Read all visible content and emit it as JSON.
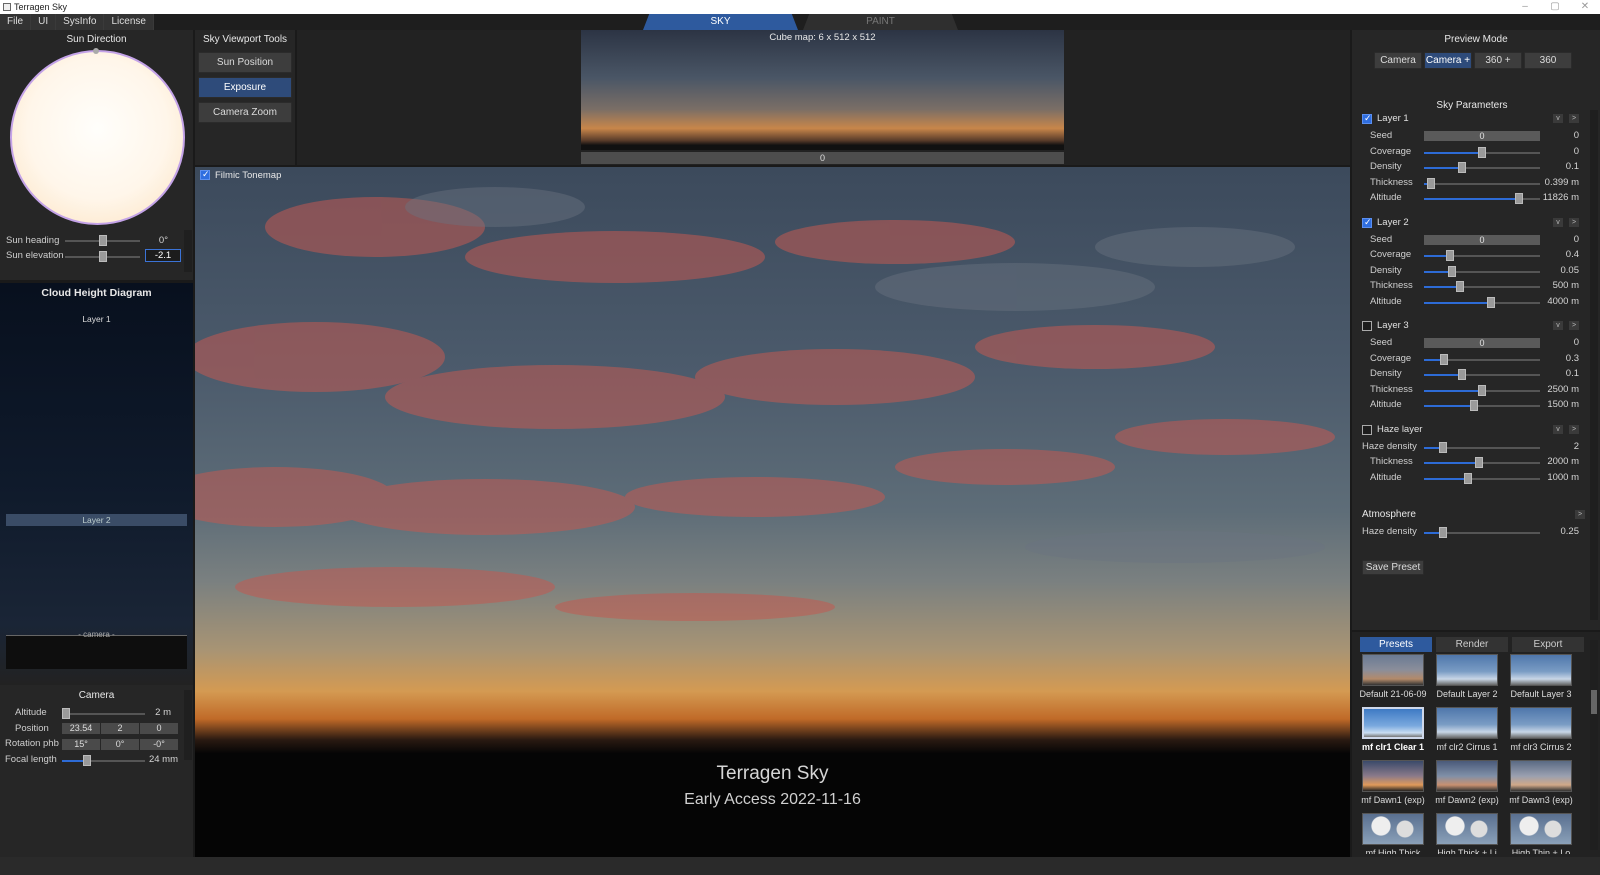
{
  "window": {
    "title": "Terragen Sky",
    "controls": [
      "–",
      "▢",
      "✕"
    ]
  },
  "menu": [
    "File",
    "UI",
    "SysInfo",
    "License"
  ],
  "top_tabs": [
    {
      "label": "SKY",
      "active": true
    },
    {
      "label": "PAINT",
      "active": false
    }
  ],
  "sun_direction": {
    "title": "Sun Direction"
  },
  "sun": {
    "heading_label": "Sun heading",
    "heading_value": "0°",
    "heading_pos": 0.5,
    "elevation_label": "Sun elevation",
    "elevation_value": "-2.1",
    "elevation_pos": 0.5
  },
  "viewport_tools": {
    "title": "Sky Viewport Tools",
    "buttons": [
      {
        "label": "Sun Position",
        "active": false
      },
      {
        "label": "Exposure",
        "active": true
      },
      {
        "label": "Camera Zoom",
        "active": false
      }
    ]
  },
  "cubemap": {
    "label": "Cube map: 6 x 512 x 512",
    "bar_value": "0"
  },
  "filmic": {
    "label": "Filmic Tonemap",
    "checked": true
  },
  "viewport_text": {
    "title": "Terragen Sky",
    "subtitle": "Early Access 2022-11-16"
  },
  "cloud_diagram": {
    "title": "Cloud Height Diagram",
    "layer1": "Layer 1",
    "layer2": "Layer 2",
    "camera": "- camera -"
  },
  "camera": {
    "title": "Camera",
    "altitude_label": "Altitude",
    "altitude_value": "2 m",
    "altitude_pos": 0.05,
    "position_label": "Position",
    "position_values": [
      "23.54",
      "2",
      "0"
    ],
    "rotation_label": "Rotation phb",
    "rotation_values": [
      "15°",
      "0°",
      "-0°"
    ],
    "focal_label": "Focal length",
    "focal_value": "24 mm",
    "focal_pos": 0.3
  },
  "preview_mode": {
    "title": "Preview Mode",
    "buttons": [
      {
        "label": "Camera",
        "active": false
      },
      {
        "label": "Camera +",
        "active": true
      },
      {
        "label": "360 +",
        "active": false
      },
      {
        "label": "360",
        "active": false
      }
    ]
  },
  "sky_params": {
    "title": "Sky Parameters",
    "layers": [
      {
        "name": "Layer 1",
        "checked": true,
        "rows": [
          {
            "label": "Seed",
            "value": "0",
            "seed": true,
            "seed_value": "0"
          },
          {
            "label": "Coverage",
            "value": "0",
            "pos": 0.5
          },
          {
            "label": "Density",
            "value": "0.1",
            "pos": 0.33
          },
          {
            "label": "Thickness",
            "value": "0.399 m",
            "pos": 0.06
          },
          {
            "label": "Altitude",
            "value": "11826 m",
            "pos": 0.82
          }
        ]
      },
      {
        "name": "Layer 2",
        "checked": true,
        "rows": [
          {
            "label": "Seed",
            "value": "0",
            "seed": true,
            "seed_value": "0"
          },
          {
            "label": "Coverage",
            "value": "0.4",
            "pos": 0.22
          },
          {
            "label": "Density",
            "value": "0.05",
            "pos": 0.24
          },
          {
            "label": "Thickness",
            "value": "500 m",
            "pos": 0.31
          },
          {
            "label": "Altitude",
            "value": "4000 m",
            "pos": 0.58
          }
        ]
      },
      {
        "name": "Layer 3",
        "checked": false,
        "rows": [
          {
            "label": "Seed",
            "value": "0",
            "seed": true,
            "seed_value": "0"
          },
          {
            "label": "Coverage",
            "value": "0.3",
            "pos": 0.17
          },
          {
            "label": "Density",
            "value": "0.1",
            "pos": 0.33
          },
          {
            "label": "Thickness",
            "value": "2500 m",
            "pos": 0.5
          },
          {
            "label": "Altitude",
            "value": "1500 m",
            "pos": 0.43
          }
        ]
      },
      {
        "name": "Haze layer",
        "checked": false,
        "rows": [
          {
            "label": "Haze density",
            "value": "2",
            "pos": 0.16
          },
          {
            "label": "Thickness",
            "value": "2000 m",
            "pos": 0.47
          },
          {
            "label": "Altitude",
            "value": "1000 m",
            "pos": 0.38
          }
        ]
      }
    ],
    "atmosphere": {
      "title": "Atmosphere",
      "label": "Haze density",
      "value": "0.25",
      "pos": 0.16
    },
    "save_preset": "Save Preset"
  },
  "bottom_tabs": [
    {
      "label": "Presets",
      "active": true
    },
    {
      "label": "Render",
      "active": false
    },
    {
      "label": "Export",
      "active": false
    }
  ],
  "presets": [
    {
      "label": "Default 21-06-09",
      "style": "dusk"
    },
    {
      "label": "Default Layer 2",
      "style": "blue"
    },
    {
      "label": "Default Layer 3",
      "style": "blue"
    },
    {
      "label": "mf clr1 Clear 1",
      "style": "clear",
      "selected": true
    },
    {
      "label": "mf clr2 Cirrus 1",
      "style": "blue"
    },
    {
      "label": "mf clr3 Cirrus 2",
      "style": "blue"
    },
    {
      "label": "mf Dawn1 (exp)",
      "style": "dawn"
    },
    {
      "label": "mf Dawn2 (exp)",
      "style": "dawn2"
    },
    {
      "label": "mf Dawn3 (exp)",
      "style": "dawn3"
    },
    {
      "label": "mf High Thick",
      "style": "cloudy"
    },
    {
      "label": "High Thick + Li",
      "style": "cloudy"
    },
    {
      "label": "High Thin + Lo",
      "style": "cloudy"
    }
  ],
  "colors": {
    "accent": "#2e4b7a",
    "slider_fill": "#2d6bd6",
    "panel": "#262626"
  }
}
